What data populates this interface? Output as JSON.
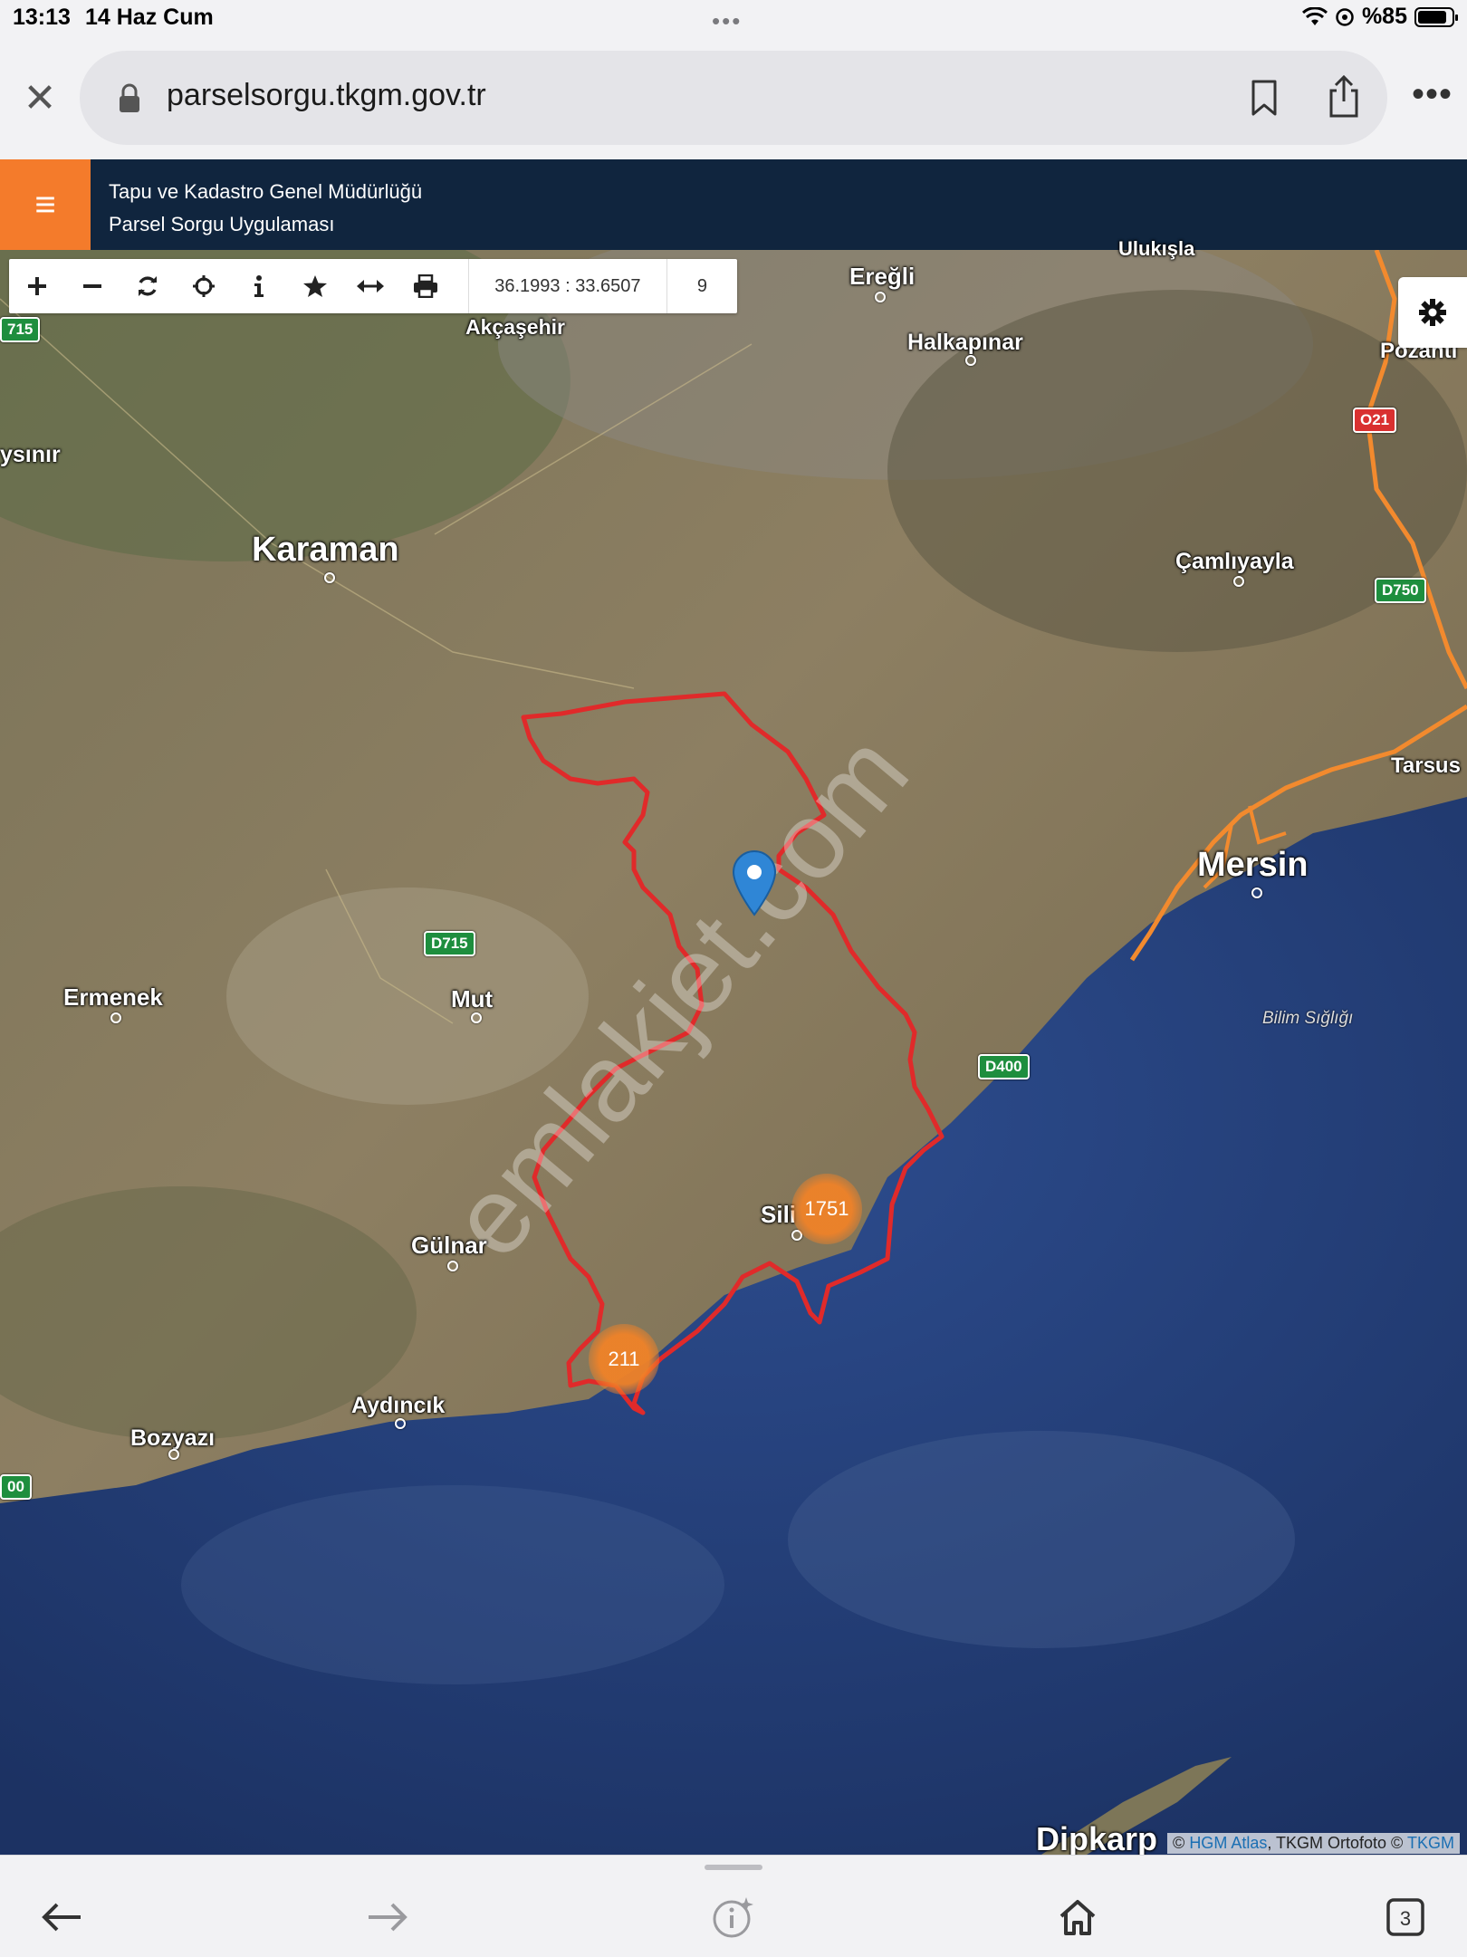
{
  "status": {
    "time": "13:13",
    "date": "14 Haz Cum",
    "battery": "%85",
    "battery_level": 0.85
  },
  "browser": {
    "url": "parselsorgu.tkgm.gov.tr",
    "tab_count": "3"
  },
  "header": {
    "org": "Tapu ve Kadastro Genel Müdürlüğü",
    "app": "Parsel Sorgu Uygulaması"
  },
  "toolbar": {
    "coords": "36.1993 : 33.6507",
    "zoom": "9"
  },
  "map": {
    "places": {
      "ulukisla": "Ulukışla",
      "eregli": "Ereğli",
      "akcasehir": "Akçaşehir",
      "halkapinar": "Halkapınar",
      "pozanti": "Pozantı",
      "aysinir": "ysınır",
      "karaman": "Karaman",
      "camliyayla": "Çamlıyayla",
      "tarsus": "Tarsus",
      "mersin": "Mersin",
      "ermenek": "Ermenek",
      "mut": "Mut",
      "silifke": "Sili",
      "gulnar": "Gülnar",
      "aydincik": "Aydıncık",
      "bozyazi": "Bozyazı",
      "dipkarpaz": "Dipkarp"
    },
    "roads": {
      "d715_left": "715",
      "d715": "D715",
      "o21": "O21",
      "d750": "D750",
      "d400": "D400",
      "d400_left": "00"
    },
    "sea_label": "Bilim Sığlığı",
    "clusters": {
      "silifke": "1751",
      "tasucu": "211"
    },
    "watermark": "emlakjet.com",
    "attribution": {
      "prefix": "©",
      "hgm": "HGM Atlas",
      "middle": ", TKGM Ortofoto ©",
      "tkgm": "TKGM"
    }
  }
}
